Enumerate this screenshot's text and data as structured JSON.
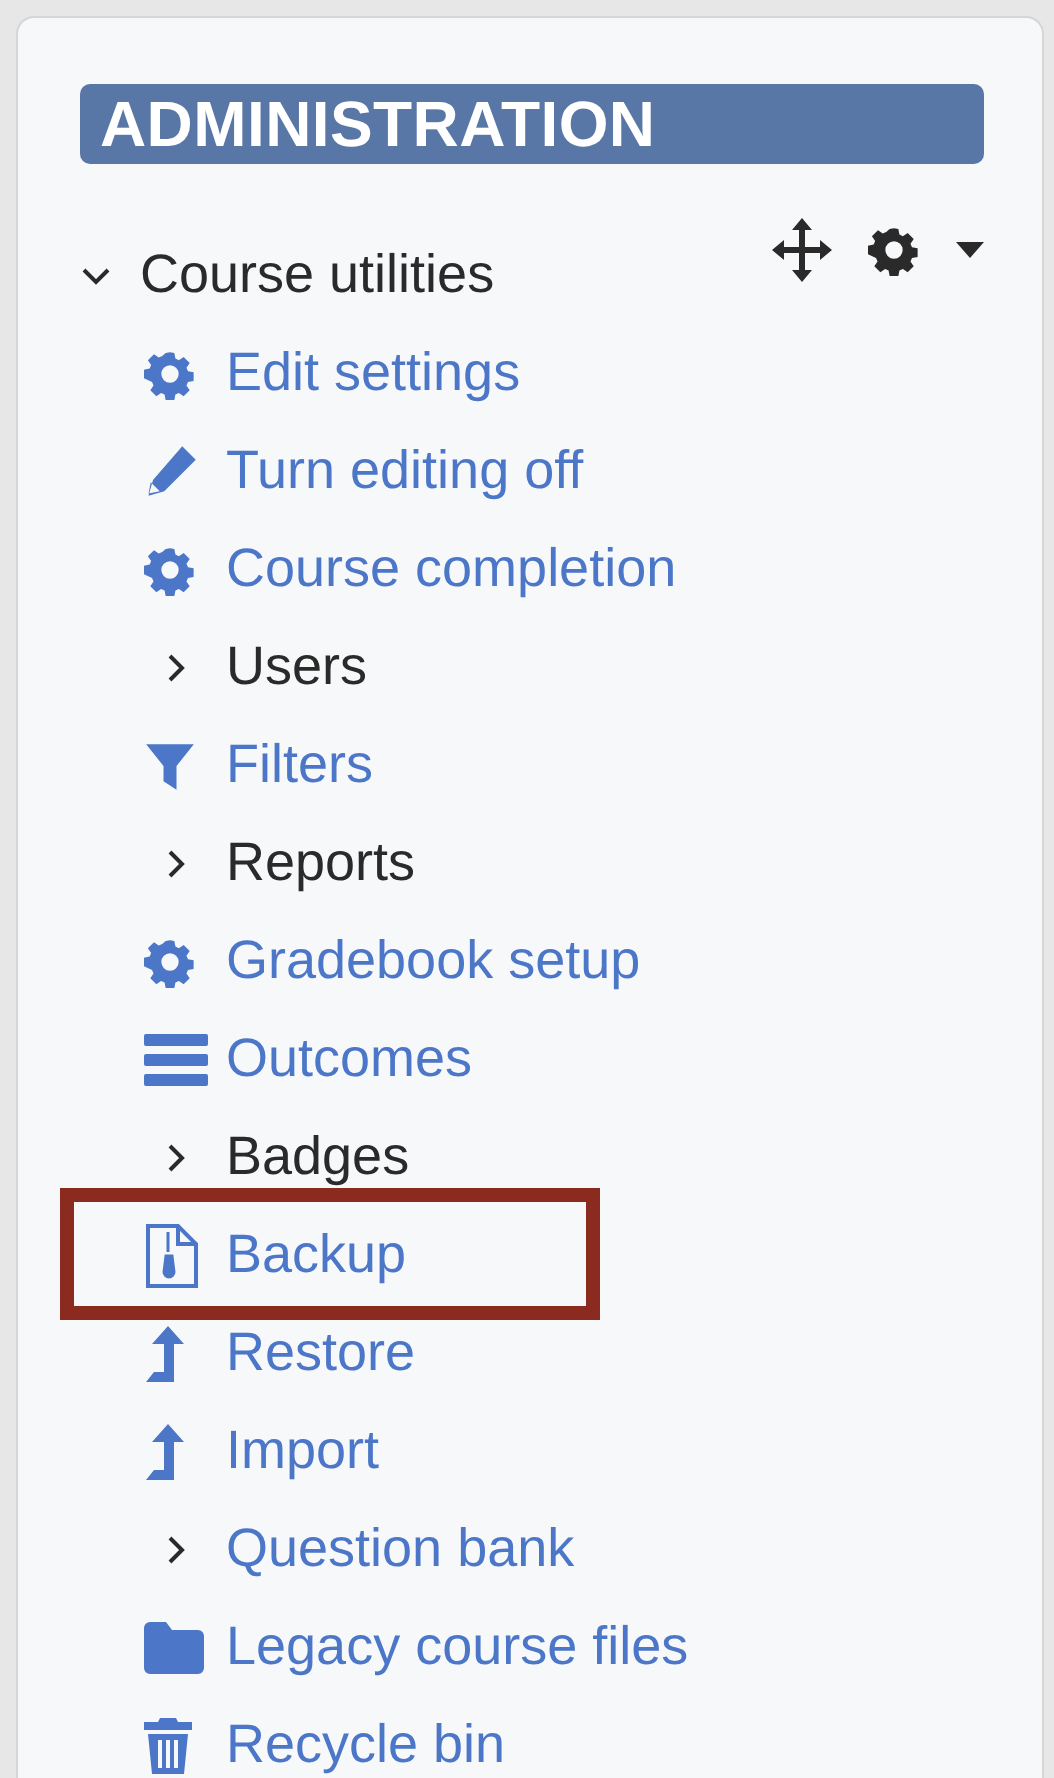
{
  "block": {
    "title": "ADMINISTRATION"
  },
  "course_utilities": {
    "label": "Course utilities",
    "expanded": true,
    "children": [
      {
        "label": "Edit settings",
        "kind": "settings",
        "highlighted": false
      },
      {
        "label": "Turn editing off",
        "kind": "edit",
        "highlighted": false
      },
      {
        "label": "Course completion",
        "kind": "settings",
        "highlighted": false
      },
      {
        "label": "Users",
        "kind": "branch",
        "linked": false,
        "expanded": false,
        "highlighted": false
      },
      {
        "label": "Filters",
        "kind": "filter",
        "highlighted": false
      },
      {
        "label": "Reports",
        "kind": "branch",
        "linked": false,
        "expanded": false,
        "highlighted": false
      },
      {
        "label": "Gradebook setup",
        "kind": "settings",
        "highlighted": false
      },
      {
        "label": "Outcomes",
        "kind": "outcomes",
        "highlighted": false
      },
      {
        "label": "Badges",
        "kind": "branch",
        "linked": false,
        "expanded": false,
        "highlighted": false
      },
      {
        "label": "Backup",
        "kind": "backup",
        "highlighted": true
      },
      {
        "label": "Restore",
        "kind": "restore",
        "highlighted": false
      },
      {
        "label": "Import",
        "kind": "restore",
        "highlighted": false
      },
      {
        "label": "Question bank",
        "kind": "branch",
        "linked": true,
        "expanded": false,
        "highlighted": false
      },
      {
        "label": "Legacy course files",
        "kind": "folder",
        "highlighted": false
      },
      {
        "label": "Recycle bin",
        "kind": "trash",
        "highlighted": false
      }
    ]
  }
}
